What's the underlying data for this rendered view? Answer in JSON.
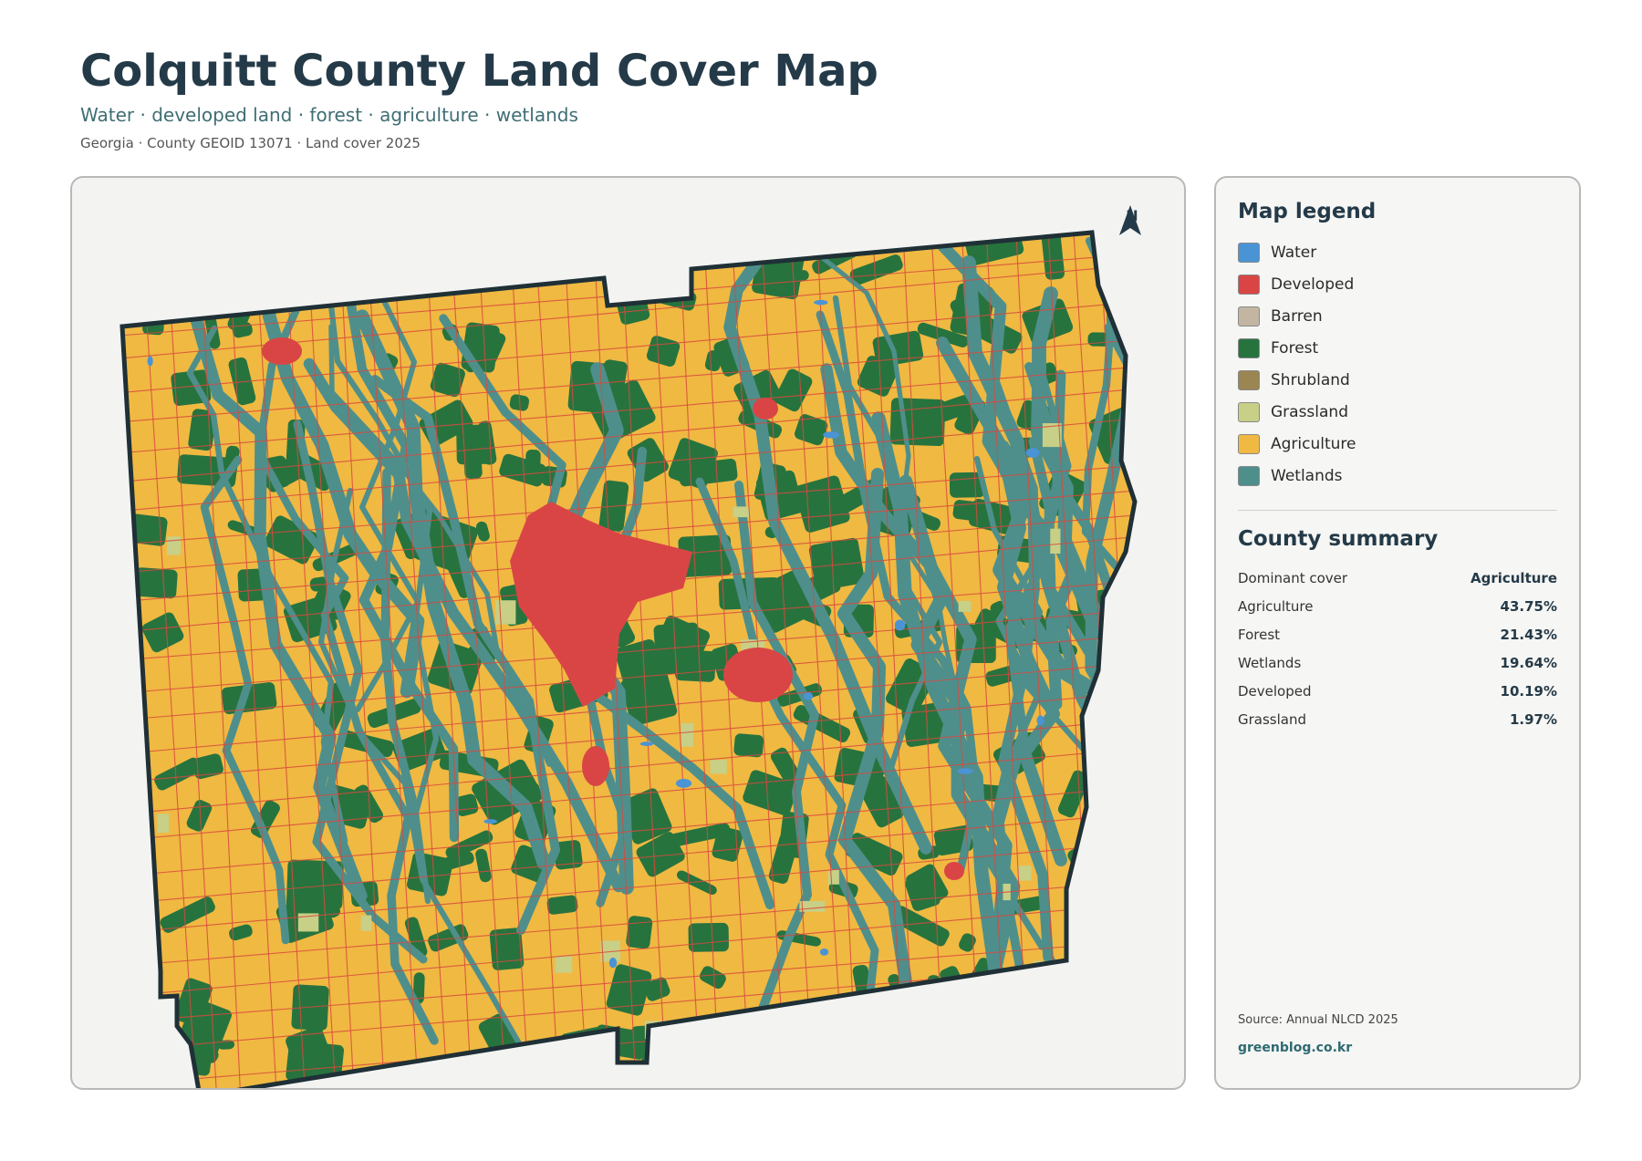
{
  "header": {
    "title": "Colquitt County Land Cover Map",
    "subtitle": "Water · developed land · forest · agriculture · wetlands",
    "meta": "Georgia · County GEOID 13071 · Land cover 2025"
  },
  "map": {
    "north_label": "N",
    "colors": {
      "agriculture": "#f0b942",
      "forest": "#27733e",
      "wetlands": "#4e8f8c",
      "developed": "#d94545",
      "water": "#4a94d6",
      "grassland": "#c8cf86",
      "barren": "#c2b6a2",
      "boundary": "#1f3036",
      "road": "#d84a3e"
    }
  },
  "legend": {
    "title": "Map legend",
    "items": [
      {
        "label": "Water",
        "color": "#4a94d6"
      },
      {
        "label": "Developed",
        "color": "#d94545"
      },
      {
        "label": "Barren",
        "color": "#c2b6a2"
      },
      {
        "label": "Forest",
        "color": "#27733e"
      },
      {
        "label": "Shrubland",
        "color": "#9b8552"
      },
      {
        "label": "Grassland",
        "color": "#c8cf86"
      },
      {
        "label": "Agriculture",
        "color": "#f0b942"
      },
      {
        "label": "Wetlands",
        "color": "#4e8f8c"
      }
    ]
  },
  "summary": {
    "title": "County summary",
    "rows": [
      {
        "label": "Dominant cover",
        "value": "Agriculture"
      },
      {
        "label": "Agriculture",
        "value": "43.75%"
      },
      {
        "label": "Forest",
        "value": "21.43%"
      },
      {
        "label": "Wetlands",
        "value": "19.64%"
      },
      {
        "label": "Developed",
        "value": "10.19%"
      },
      {
        "label": "Grassland",
        "value": "1.97%"
      }
    ]
  },
  "footer": {
    "source": "Source: Annual NLCD 2025",
    "site": "greenblog.co.kr"
  }
}
